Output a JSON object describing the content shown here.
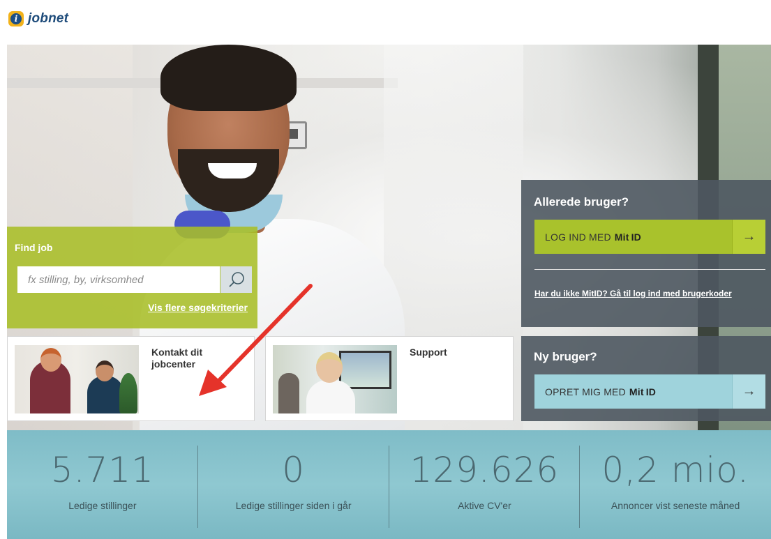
{
  "brand": {
    "logo_letter": "i",
    "name": "jobnet"
  },
  "find_job": {
    "title": "Find job",
    "search_placeholder": "fx stilling, by, virksomhed",
    "more_criteria_link": "Vis flere søgekriterier"
  },
  "cards": {
    "kontakt_label": "Kontakt dit jobcenter",
    "support_label": "Support"
  },
  "login": {
    "title": "Allerede bruger?",
    "button_text": "LOG IND MED",
    "button_brand": "Mit ID",
    "codes_link": "Har du ikke MitID? Gå til log ind med brugerkoder"
  },
  "new_user": {
    "title": "Ny bruger?",
    "button_text": "OPRET MIG MED",
    "button_brand": "Mit ID"
  },
  "arrow_glyph": "→",
  "stats": [
    {
      "value": "5.711",
      "label": "Ledige stillinger"
    },
    {
      "value": "0",
      "label": "Ledige stillinger siden i går"
    },
    {
      "value": "129.626",
      "label": "Aktive CV'er"
    },
    {
      "value": "0,2 mio.",
      "label": "Annoncer vist seneste måned"
    }
  ],
  "colors": {
    "accent_green": "#a9c22c",
    "accent_teal": "#9fd3dc",
    "stats_band": "#8fc8d1",
    "panel_dark": "#4e5860",
    "annotation_red": "#e5332a"
  }
}
